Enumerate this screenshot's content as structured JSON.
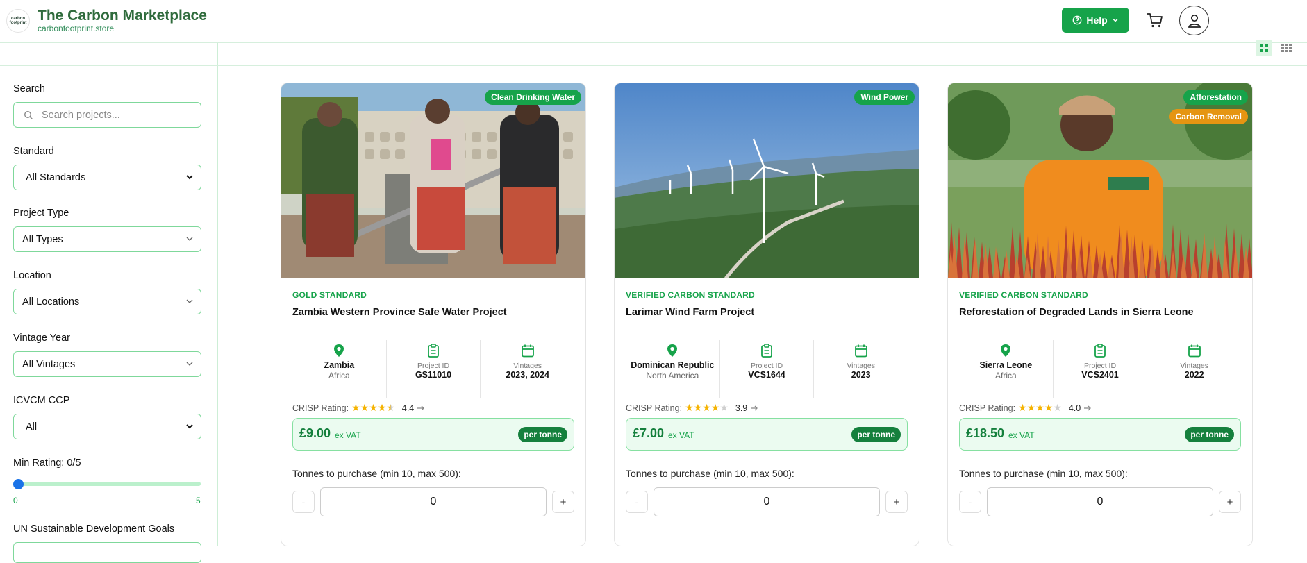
{
  "header": {
    "logo_text": "carbon footprint",
    "title": "The Carbon Marketplace",
    "url": "carbonfootprint.store",
    "help_label": "Help"
  },
  "sidebar": {
    "search_label": "Search",
    "search_placeholder": "Search projects...",
    "standard_label": "Standard",
    "standard_value": "All Standards",
    "type_label": "Project Type",
    "type_value": "All Types",
    "location_label": "Location",
    "location_value": "All Locations",
    "vintage_label": "Vintage Year",
    "vintage_value": "All Vintages",
    "icvcm_label": "ICVCM CCP",
    "icvcm_value": "All",
    "rating_label": "Min Rating: 0/5",
    "rating_value": 0,
    "rating_min": "0",
    "rating_max": "5",
    "sdg_label": "UN Sustainable Development Goals"
  },
  "colors": {
    "brand": "#2f6b3c",
    "accent": "#16a34a",
    "price_bg": "#ebfbf0",
    "slider_thumb": "#1a73e8",
    "badge_orange": "#e59512"
  },
  "cards": [
    {
      "badges": [
        "Clean Drinking Water"
      ],
      "standard": "GOLD STANDARD",
      "title": "Zambia Western Province Safe Water Project",
      "country": "Zambia",
      "region": "Africa",
      "project_id_label": "Project ID",
      "project_id": "GS11010",
      "vintages_label": "Vintages",
      "vintages": "2023, 2024",
      "crisp_label": "CRISP Rating:",
      "rating": "4.4",
      "stars_filled": 4.5,
      "price": "£9.00",
      "vat": "ex VAT",
      "per": "per tonne",
      "qty_label": "Tonnes to purchase (min 10, max 500):",
      "qty": "0"
    },
    {
      "badges": [
        "Wind Power"
      ],
      "standard": "VERIFIED CARBON STANDARD",
      "title": "Larimar Wind Farm Project",
      "country": "Dominican Republic",
      "region": "North America",
      "project_id_label": "Project ID",
      "project_id": "VCS1644",
      "vintages_label": "Vintages",
      "vintages": "2023",
      "crisp_label": "CRISP Rating:",
      "rating": "3.9",
      "stars_filled": 4,
      "price": "£7.00",
      "vat": "ex VAT",
      "per": "per tonne",
      "qty_label": "Tonnes to purchase (min 10, max 500):",
      "qty": "0"
    },
    {
      "badges": [
        "Afforestation",
        "Carbon Removal"
      ],
      "standard": "VERIFIED CARBON STANDARD",
      "title": "Reforestation of Degraded Lands in Sierra Leone",
      "country": "Sierra Leone",
      "region": "Africa",
      "project_id_label": "Project ID",
      "project_id": "VCS2401",
      "vintages_label": "Vintages",
      "vintages": "2022",
      "crisp_label": "CRISP Rating:",
      "rating": "4.0",
      "stars_filled": 4,
      "price": "£18.50",
      "vat": "ex VAT",
      "per": "per tonne",
      "qty_label": "Tonnes to purchase (min 10, max 500):",
      "qty": "0"
    }
  ]
}
